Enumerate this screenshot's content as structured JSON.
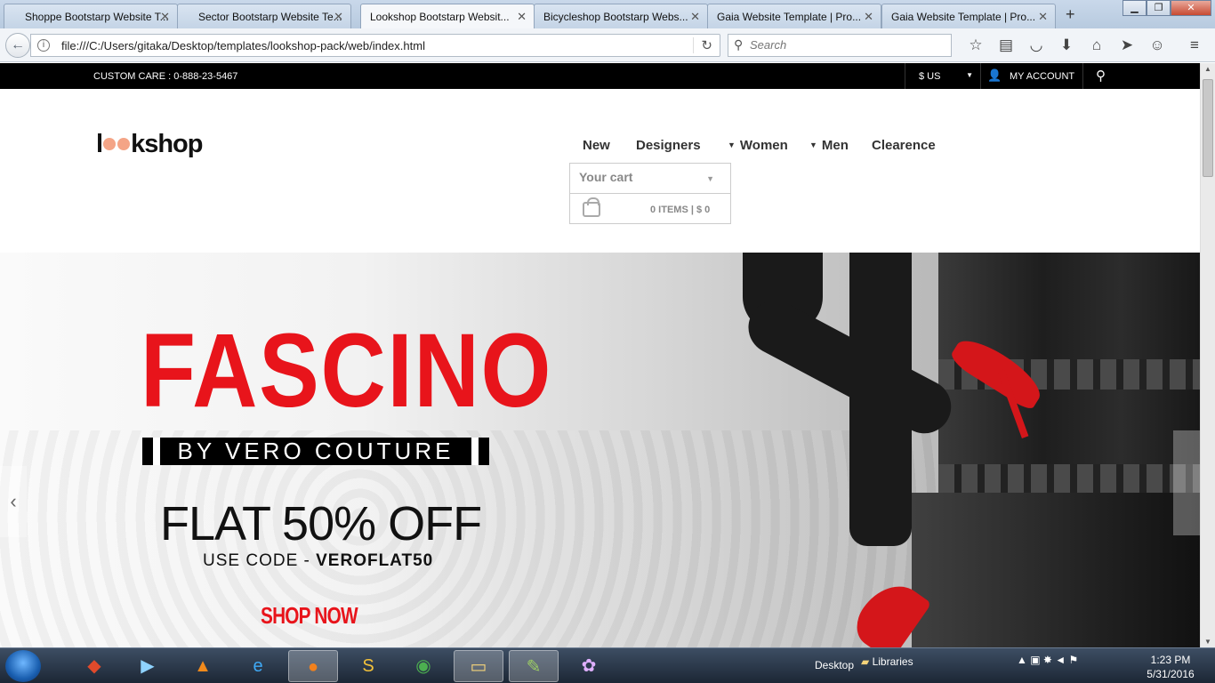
{
  "browser": {
    "tabs": [
      {
        "label": "Shoppe Bootstarp Website T..."
      },
      {
        "label": "Sector Bootstarp Website Te..."
      },
      {
        "label": "Lookshop Bootstarp Websit..."
      },
      {
        "label": "Bicycleshop Bootstarp Webs..."
      },
      {
        "label": "Gaia Website Template | Pro..."
      },
      {
        "label": "Gaia Website Template | Pro..."
      }
    ],
    "active_tab": 2,
    "url": "file:///C:/Users/gitaka/Desktop/templates/lookshop-pack/web/index.html",
    "search_placeholder": "Search"
  },
  "topbar": {
    "customer_care": "CUSTOM CARE : 0-888-23-5467",
    "currency": "$ US",
    "account": "MY ACCOUNT"
  },
  "logo": {
    "pre": "l",
    "post": "kshop",
    "accent_color": "#f4a486"
  },
  "nav": {
    "items": [
      "New",
      "Designers",
      "Women",
      "Men",
      "Clearence"
    ]
  },
  "cart": {
    "title": "Your cart",
    "summary": "0 ITEMS | $ 0"
  },
  "hero": {
    "headline": "FASCINO",
    "byline": "BY VERO COUTURE",
    "offer": "FLAT 50% OFF",
    "code_label": "USE CODE - ",
    "code_value": "VEROFLAT50",
    "cta": "SHOP NOW",
    "brand_color": "#e8141b"
  },
  "taskbar": {
    "desktop_label": "Desktop",
    "libraries_label": "Libraries",
    "time": "1:23 PM",
    "date": "5/31/2016"
  }
}
